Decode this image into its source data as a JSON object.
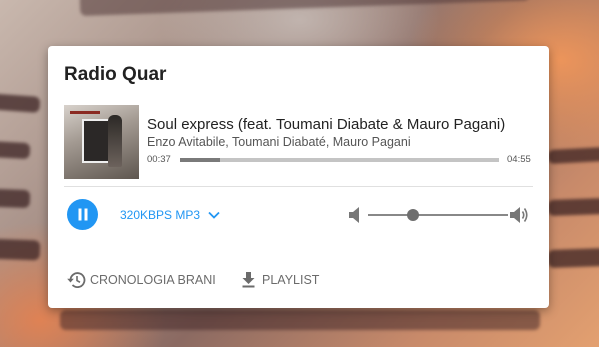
{
  "station": {
    "title": "Radio Quar"
  },
  "track": {
    "title": "Soul express (feat. Toumani Diabate & Mauro Pagani)",
    "artists": "Enzo Avitabile, Toumani Diabaté, Mauro Pagani",
    "current_time": "00:37",
    "duration": "04:55",
    "progress": 0.125,
    "cover_icon": "album-cover"
  },
  "controls": {
    "play_state": "playing",
    "play_icon": "pause-icon",
    "quality_label": "320KBPS MP3",
    "quality_icon": "chevron-down-icon",
    "volume": 0.32,
    "volume_min_icon": "volume-down-icon",
    "volume_max_icon": "volume-up-icon"
  },
  "actions": {
    "history_label": "CRONOLOGIA BRANI",
    "history_icon": "history-icon",
    "playlist_label": "PLAYLIST",
    "playlist_icon": "download-icon"
  },
  "colors": {
    "accent": "#2196f3",
    "card": "#ffffff",
    "muted_text": "#6b6b6b"
  }
}
